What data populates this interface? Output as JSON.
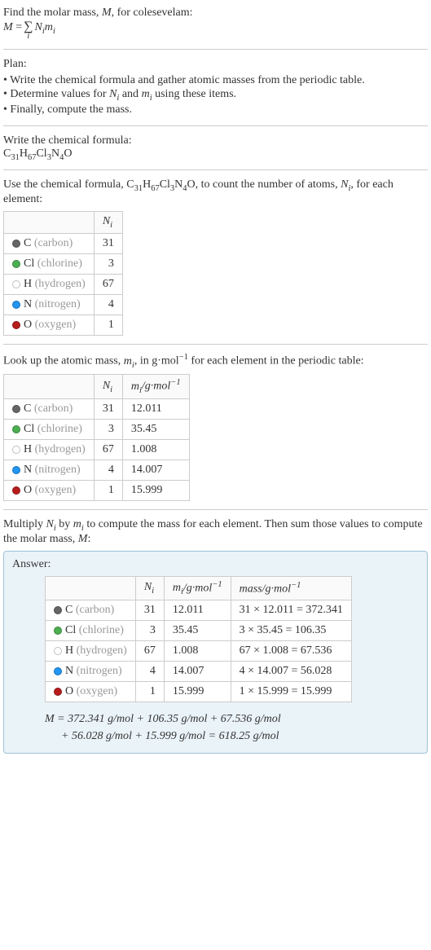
{
  "intro": {
    "line1": "Find the molar mass, M, for colesevelam:",
    "eq_lhs": "M = ",
    "eq_sigma": "∑",
    "eq_sub": "i",
    "eq_rhs": " N",
    "eq_rhs2": "m",
    "eq_i": "i"
  },
  "plan": {
    "title": "Plan:",
    "items": [
      "• Write the chemical formula and gather atomic masses from the periodic table.",
      "• Determine values for Nᵢ and mᵢ using these items.",
      "• Finally, compute the mass."
    ]
  },
  "formula_section": {
    "title": "Write the chemical formula:",
    "formula_parts": [
      "C",
      "31",
      "H",
      "67",
      "Cl",
      "3",
      "N",
      "4",
      "O"
    ]
  },
  "count_section": {
    "intro_a": "Use the chemical formula, C",
    "intro_b": "H",
    "intro_c": "Cl",
    "intro_d": "N",
    "intro_e": "O, to count the number of atoms, N",
    "intro_f": ", for",
    "intro_g": "each element:",
    "header_n": "N",
    "header_i": "i"
  },
  "elements": [
    {
      "dot": "dot-c",
      "sym": "C",
      "name": "(carbon)",
      "n": "31",
      "m": "12.011",
      "mass": "31 × 12.011 = 372.341"
    },
    {
      "dot": "dot-cl",
      "sym": "Cl",
      "name": "(chlorine)",
      "n": "3",
      "m": "35.45",
      "mass": "3 × 35.45 = 106.35"
    },
    {
      "dot": "dot-h",
      "sym": "H",
      "name": "(hydrogen)",
      "n": "67",
      "m": "1.008",
      "mass": "67 × 1.008 = 67.536"
    },
    {
      "dot": "dot-n",
      "sym": "N",
      "name": "(nitrogen)",
      "n": "4",
      "m": "14.007",
      "mass": "4 × 14.007 = 56.028"
    },
    {
      "dot": "dot-o",
      "sym": "O",
      "name": "(oxygen)",
      "n": "1",
      "m": "15.999",
      "mass": "1 × 15.999 = 15.999"
    }
  ],
  "lookup_section": {
    "intro_a": "Look up the atomic mass, m",
    "intro_b": ", in g·mol",
    "intro_c": " for each element in the periodic table:",
    "header_m_a": "m",
    "header_m_b": "/g·mol",
    "neg1": "−1",
    "sub_i": "i"
  },
  "multiply_section": {
    "line1": "Multiply Nᵢ by mᵢ to compute the mass for each element. Then sum those values",
    "line2": "to compute the molar mass, M:"
  },
  "answer": {
    "label": "Answer:",
    "mass_header": "mass/g·mol",
    "final_line1": "M = 372.341 g/mol + 106.35 g/mol + 67.536 g/mol",
    "final_line2": "+ 56.028 g/mol + 15.999 g/mol = 618.25 g/mol"
  }
}
